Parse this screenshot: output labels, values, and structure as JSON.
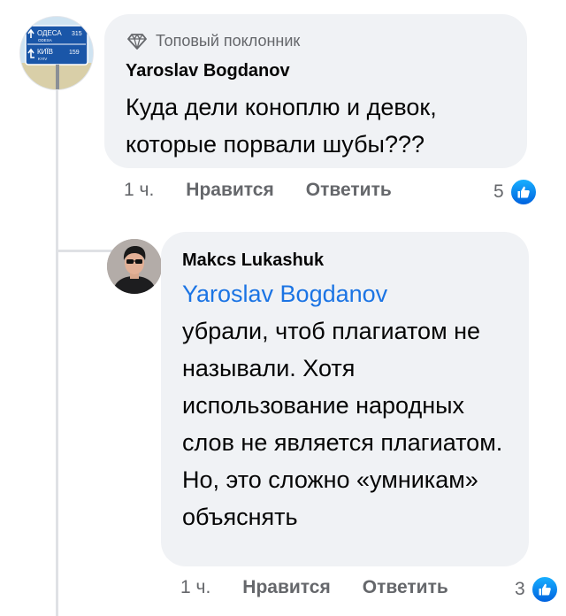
{
  "comment": {
    "badge": "Топовый поклонник",
    "author": "Yaroslav Bogdanov",
    "text": "Куда дели коноплю и девок, которые порвали шубы???",
    "time": "1 ч.",
    "like_label": "Нравится",
    "reply_label": "Ответить",
    "reactions_count": "5",
    "avatar_sign": {
      "line1": "ОДЕСА",
      "line1_small": "ODESA",
      "line1_num": "315",
      "line2": "КИЇВ",
      "line2_small": "KYIV",
      "line2_num": "159"
    }
  },
  "reply": {
    "author": "Makcs Lukashuk",
    "mention": "Yaroslav Bogdanov",
    "text": "убрали, чтоб плагиатом не называли. Хотя использование народных слов не является плагиатом. Но, это сложно «умникам» объяснять",
    "time": "1 ч.",
    "like_label": "Нравится",
    "reply_label": "Ответить",
    "reactions_count": "3"
  },
  "icons": {
    "badge": "diamond-icon",
    "reaction": "like-thumbs-up-icon"
  },
  "colors": {
    "bubble_bg": "#f0f2f5",
    "mention": "#1b74e4",
    "secondary_text": "#65676b",
    "like_blue": "#1877f2"
  }
}
